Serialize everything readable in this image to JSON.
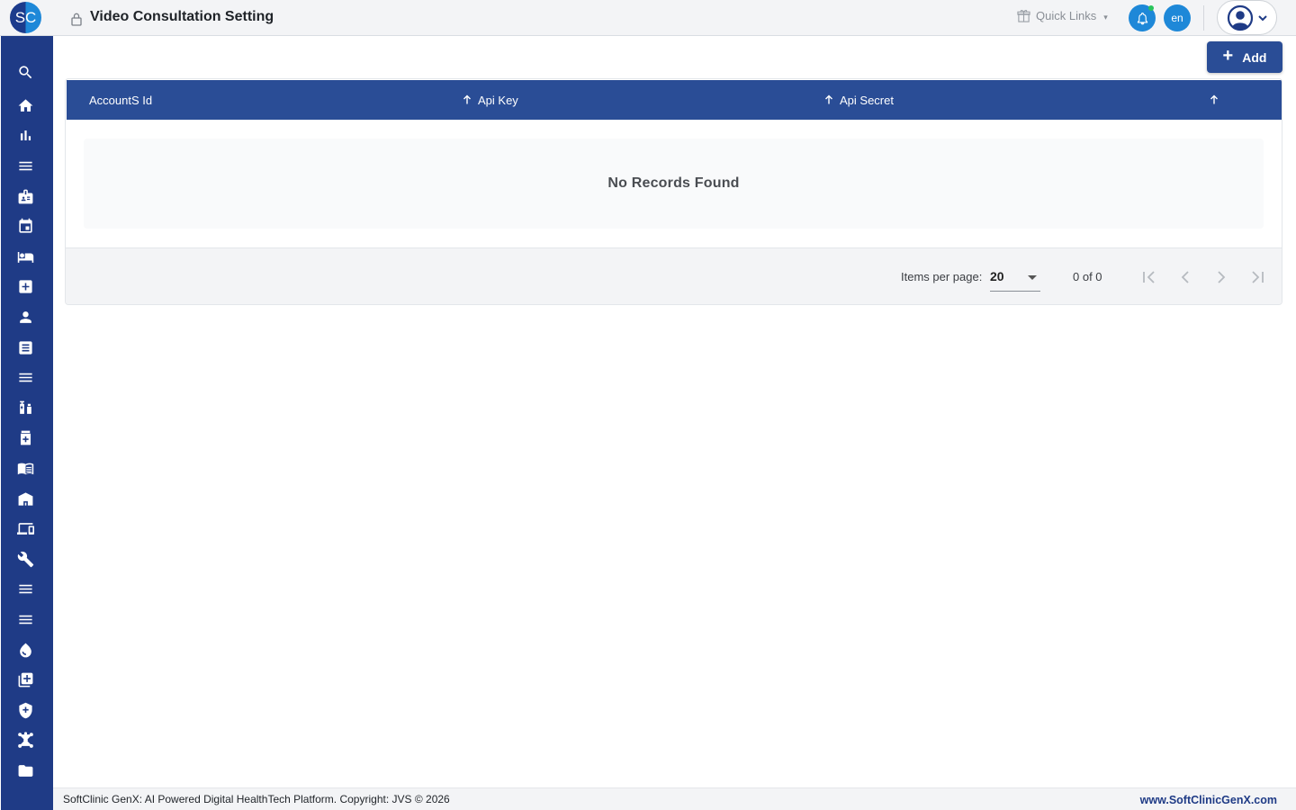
{
  "header": {
    "logo_text": "SC",
    "title": "Video Consultation Setting",
    "quick_links_label": "Quick Links",
    "language_label": "en"
  },
  "sidebar": {
    "items": [
      {
        "icon": "search-icon"
      },
      {
        "icon": "home-icon"
      },
      {
        "icon": "bar-chart-icon"
      },
      {
        "icon": "menu-icon"
      },
      {
        "icon": "badge-icon"
      },
      {
        "icon": "calendar-icon"
      },
      {
        "icon": "bed-icon"
      },
      {
        "icon": "medical-plus-icon"
      },
      {
        "icon": "person-icon"
      },
      {
        "icon": "list-document-icon"
      },
      {
        "icon": "menu-icon"
      },
      {
        "icon": "pharmacy-icon"
      },
      {
        "icon": "medicine-box-icon"
      },
      {
        "icon": "book-icon"
      },
      {
        "icon": "store-icon"
      },
      {
        "icon": "devices-icon"
      },
      {
        "icon": "wrench-icon"
      },
      {
        "icon": "menu-icon"
      },
      {
        "icon": "menu-icon"
      },
      {
        "icon": "blood-drop-icon"
      },
      {
        "icon": "add-library-icon"
      },
      {
        "icon": "shield-icon"
      },
      {
        "icon": "network-icon"
      },
      {
        "icon": "folder-icon"
      }
    ]
  },
  "toolbar": {
    "add_label": "Add"
  },
  "table": {
    "columns": [
      "AccountS Id",
      "Api Key",
      "Api Secret"
    ],
    "empty_message": "No Records Found"
  },
  "paginator": {
    "items_per_page_label": "Items per page:",
    "items_per_page_value": "20",
    "range_label": "0 of 0"
  },
  "footer": {
    "copyright": "SoftClinic GenX: AI Powered Digital HealthTech Platform. Copyright: JVS © 2026",
    "website": "www.SoftClinicGenX.com"
  },
  "colors": {
    "primary": "#1f3b86",
    "header_row": "#2a4d96",
    "accent": "#1e88d8"
  }
}
